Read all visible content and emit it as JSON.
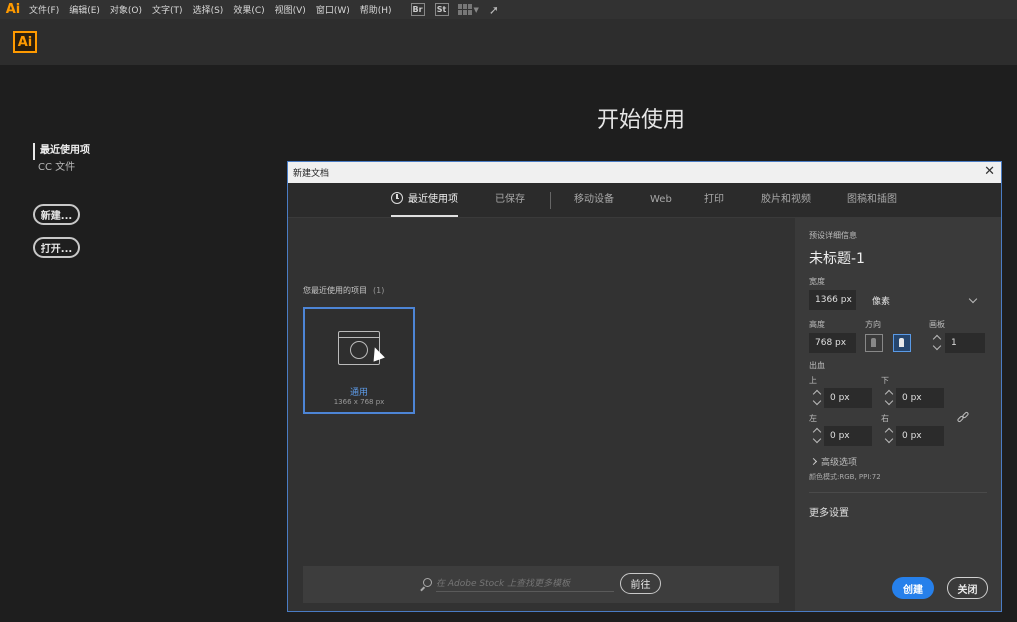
{
  "app": {
    "logo_small": "Ai",
    "logo": "Ai"
  },
  "menubar": {
    "items": [
      "文件(F)",
      "编辑(E)",
      "对象(O)",
      "文字(T)",
      "选择(S)",
      "效果(C)",
      "视图(V)",
      "窗口(W)",
      "帮助(H)"
    ],
    "icons": {
      "bridge": "Br",
      "stock": "St"
    }
  },
  "start": {
    "title": "开始使用",
    "nav": [
      "最近使用项",
      "CC 文件"
    ],
    "new_button": "新建...",
    "open_button": "打开..."
  },
  "dialog": {
    "title": "新建文档",
    "tabs": [
      "最近使用项",
      "已保存",
      "移动设备",
      "Web",
      "打印",
      "胶片和视频",
      "图稿和插图"
    ],
    "active_tab": "最近使用项",
    "recent_label": "您最近使用的项目",
    "recent_count": "(1)",
    "card": {
      "name": "通用",
      "size": "1366 x 768 px"
    },
    "stock": {
      "placeholder": "在 Adobe Stock 上查找更多模板",
      "go_button": "前往"
    },
    "details": {
      "header": "预设详细信息",
      "doc_name": "未标题-1",
      "width_label": "宽度",
      "width": "1366 px",
      "unit": "像素",
      "height_label": "高度",
      "height": "768 px",
      "orientation_label": "方向",
      "artboards_label": "画板",
      "artboards": "1",
      "bleed_label": "出血",
      "top_label": "上",
      "bottom_label": "下",
      "left_label": "左",
      "right_label": "右",
      "bleed_top": "0 px",
      "bleed_bottom": "0 px",
      "bleed_left": "0 px",
      "bleed_right": "0 px",
      "advanced": "高级选项",
      "color_mode": "颜色模式:RGB, PPI:72",
      "more_settings": "更多设置",
      "create_button": "创建",
      "close_button": "关闭"
    }
  },
  "colors": {
    "accent": "#2680eb",
    "brand": "#ff9a00",
    "selection": "#4d85d6"
  }
}
